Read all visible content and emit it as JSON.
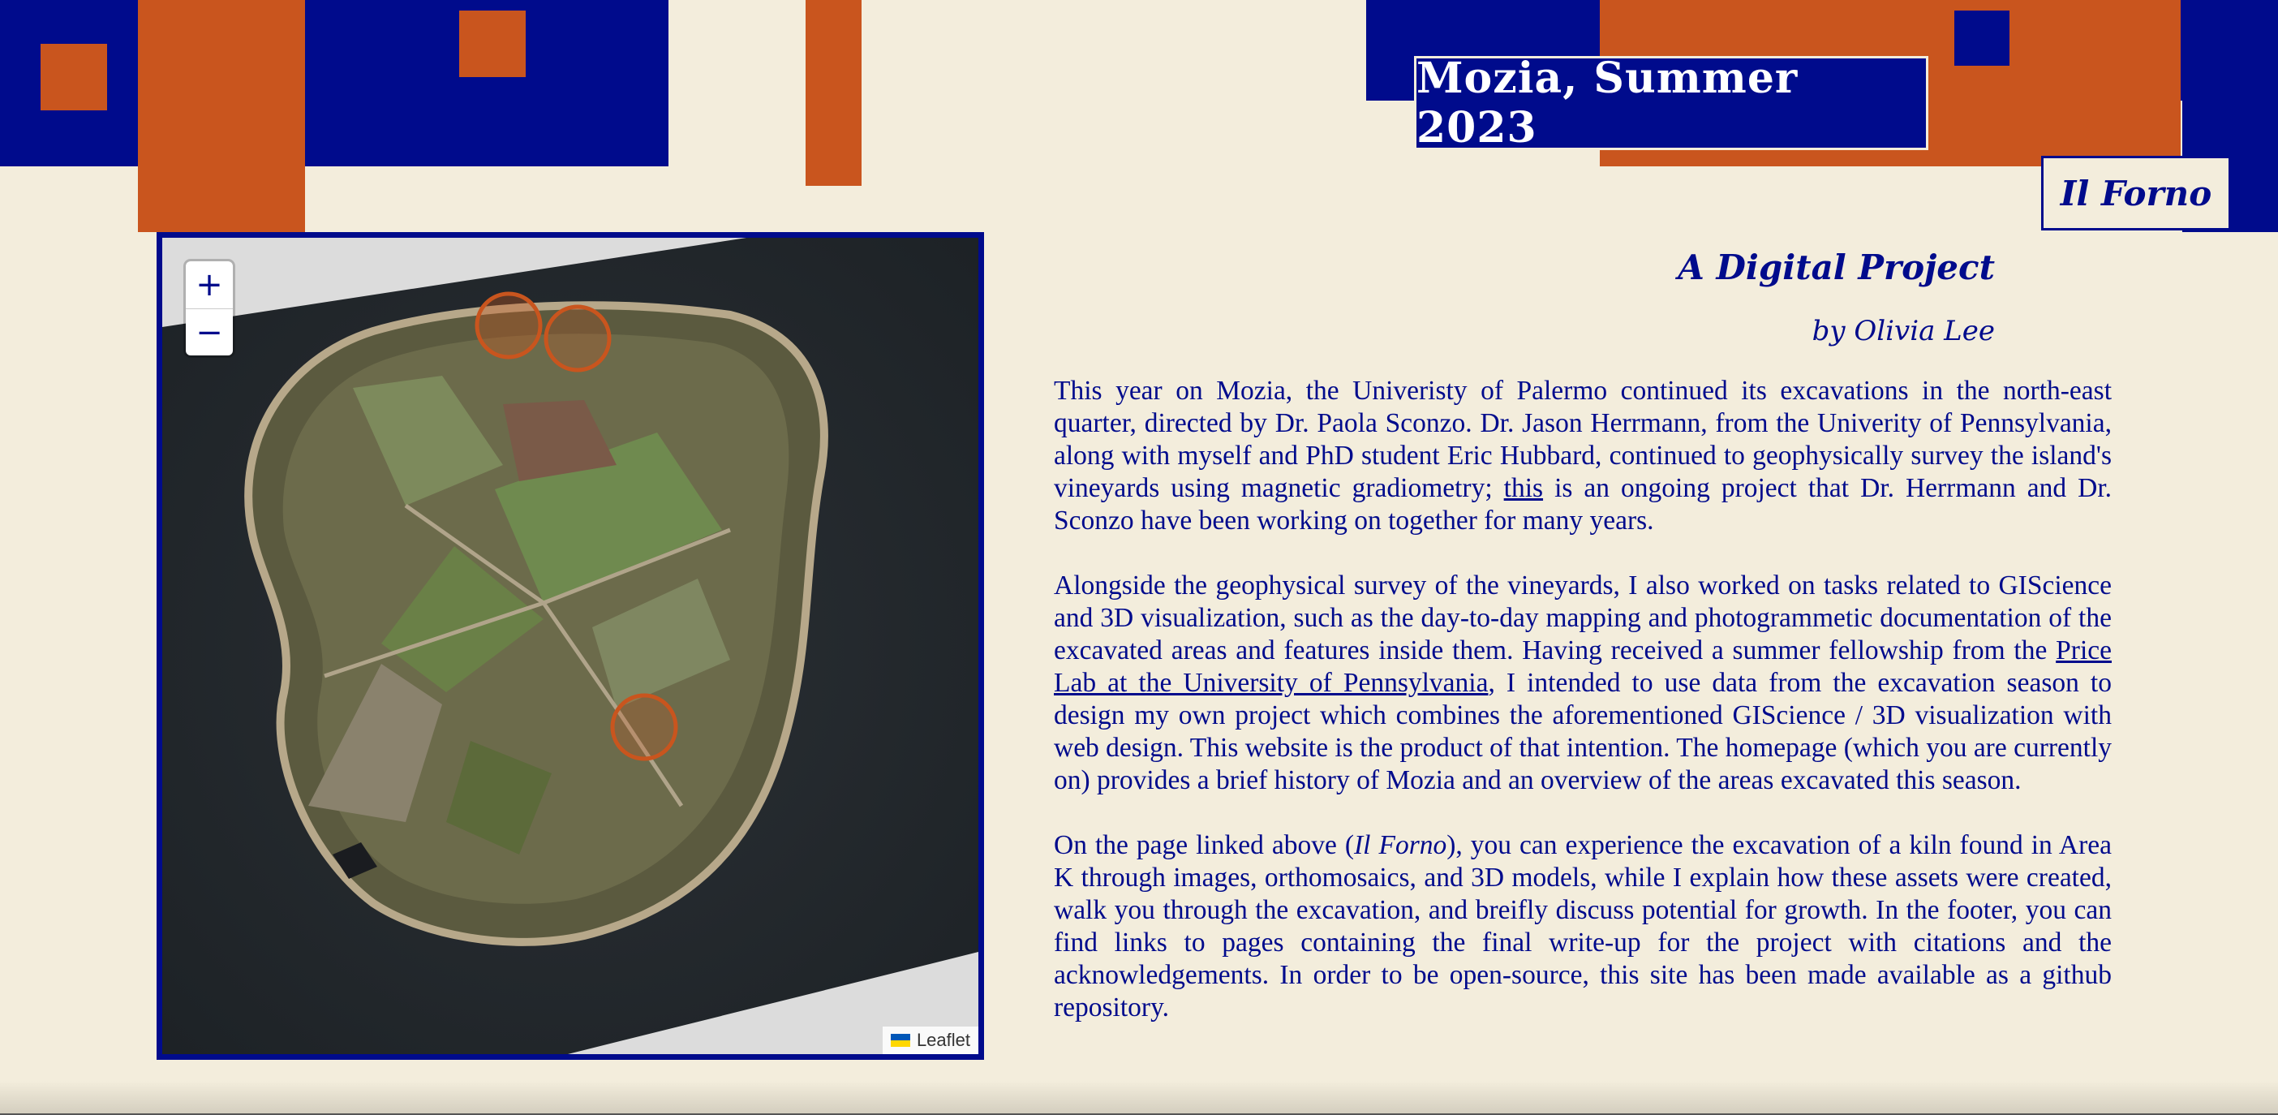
{
  "header": {
    "site_title": "Mozia, Summer 2023",
    "nav_link": "Il Forno"
  },
  "colors": {
    "background": "#f3eddc",
    "navy": "#000b8c",
    "orange": "#c9551e"
  },
  "map": {
    "zoom_in": "+",
    "zoom_out": "−",
    "attribution": "Leaflet",
    "markers": [
      "marker-north-1",
      "marker-north-2",
      "marker-center"
    ]
  },
  "main": {
    "heading": "A Digital Project",
    "byline": "by Olivia Lee",
    "p1": {
      "a": "This year on Mozia, the Univeristy of Palermo continued its excavations in the north-east quarter, directed by Dr. Paola Sconzo. Dr. Jason Herrmann, from the Univerity of Pennsylvania, along with myself and PhD student Eric Hubbard, continued to geophysically survey the island's vineyards using magnetic gradiometry; ",
      "link": "this",
      "b": " is an ongoing project that Dr. Herrmann and Dr. Sconzo have been working on together for many years."
    },
    "p2": {
      "a": "Alongside the geophysical survey of the vineyards, I also worked on tasks related to GIScience and 3D visualization, such as the day-to-day mapping and photogrammetic documentation of the excavated areas and features inside them. Having received a summer fellowship from the ",
      "link": "Price Lab at the University of Pennsylvania",
      "b": ", I intended to use data from the excavation season to design my own project which combines the aforementioned GIScience / 3D visualization with web design. This website is the product of that intention. The homepage (which you are currently on) provides a brief history of Mozia and an overview of the areas excavated this season."
    },
    "p3": {
      "a": "On the page linked above (",
      "em": "Il Forno",
      "b": "), you can experience the excavation of a kiln found in Area K through images, orthomosaics, and 3D models, while I explain how these assets were created, walk you through the excavation, and breifly discuss potential for growth. In the footer, you can find links to pages containing the final write-up for the project with citations and the acknowledgements. In order to be open-source, this site has been made available as a github repository."
    }
  }
}
